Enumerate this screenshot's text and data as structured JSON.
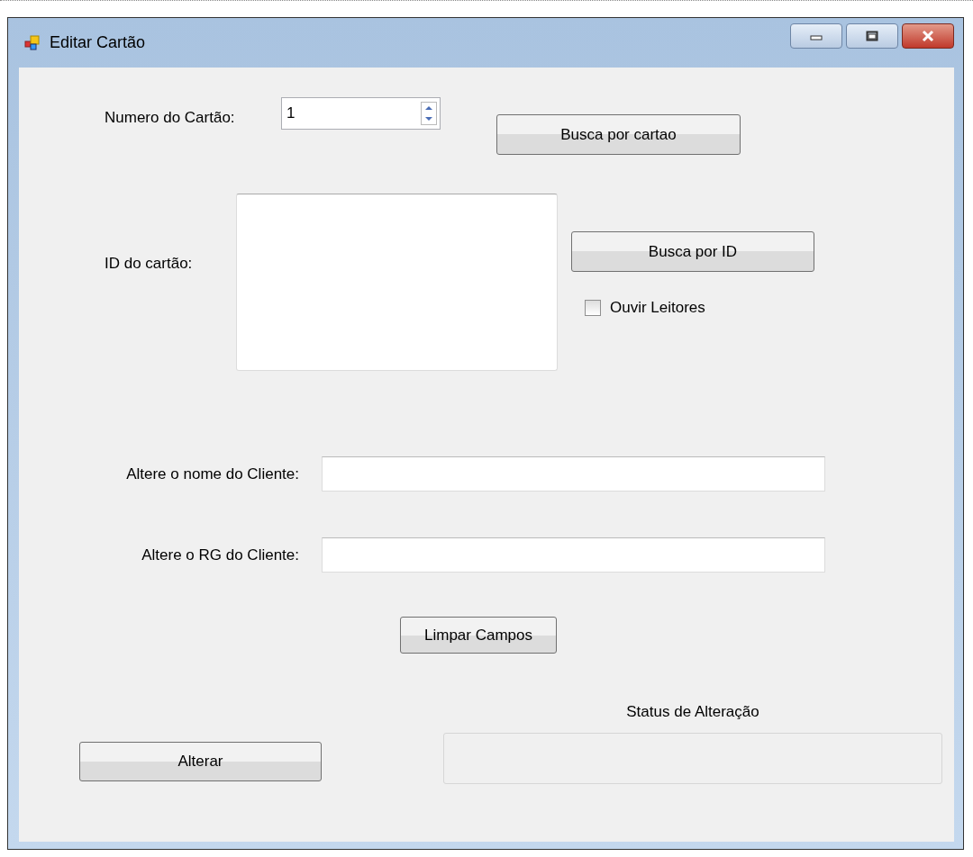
{
  "window": {
    "title": "Editar Cartão"
  },
  "card_number": {
    "label": "Numero do Cartão:",
    "value": "1"
  },
  "search_card_button": "Busca por cartao",
  "card_id": {
    "label": "ID do cartão:"
  },
  "search_id_button": "Busca por ID",
  "listen_readers": {
    "label": "Ouvir Leitores",
    "checked": false
  },
  "client_name": {
    "label": "Altere o nome do Cliente:"
  },
  "client_rg": {
    "label": "Altere o RG do Cliente:"
  },
  "clear_button": "Limpar Campos",
  "status": {
    "label": "Status de Alteração"
  },
  "change_button": "Alterar"
}
